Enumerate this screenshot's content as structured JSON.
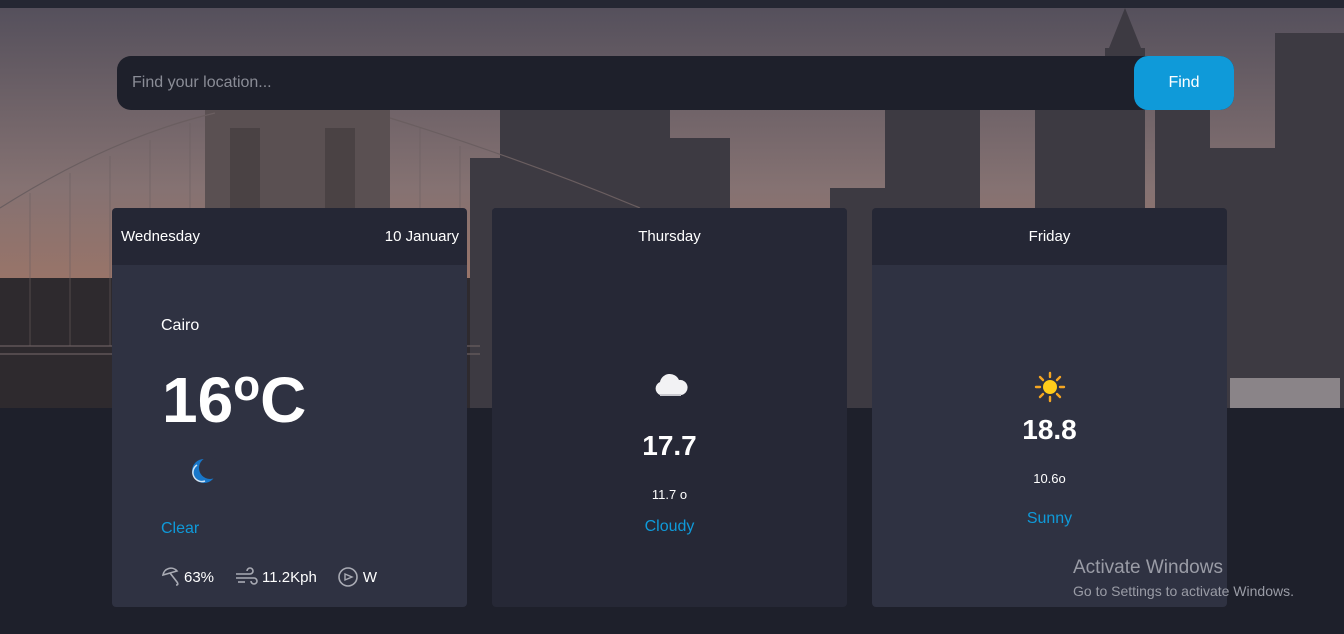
{
  "search": {
    "placeholder": "Find your location...",
    "button_label": "Find"
  },
  "today": {
    "day": "Wednesday",
    "date": "10 January",
    "city": "Cairo",
    "temp": "16",
    "unit": "C",
    "condition": "Clear",
    "condition_icon": "moon-icon",
    "humidity": "63%",
    "wind_speed": "11.2Kph",
    "wind_dir": "W"
  },
  "forecast": [
    {
      "day": "Thursday",
      "max": "17.7",
      "min": "11.7 o",
      "condition": "Cloudy",
      "icon": "cloud-icon"
    },
    {
      "day": "Friday",
      "max": "18.8",
      "min": "10.6o",
      "condition": "Sunny",
      "icon": "sun-icon"
    }
  ],
  "watermark": {
    "title": "Activate Windows",
    "subtitle": "Go to Settings to activate Windows."
  },
  "colors": {
    "accent": "#0f9ad9",
    "background": "#1e202b",
    "card": "#2f3242",
    "card_header": "#252735"
  }
}
